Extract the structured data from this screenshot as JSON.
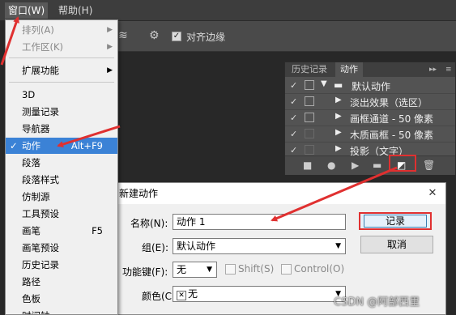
{
  "menubar": {
    "items": [
      {
        "label": "窗口(W)"
      },
      {
        "label": "帮助(H)"
      }
    ]
  },
  "options_bar": {
    "align_edges_label": "对齐边缘",
    "icons": [
      "layers-icon",
      "gear-icon"
    ]
  },
  "window_menu": {
    "items": [
      {
        "label": "排列(A)",
        "disabled": true,
        "submenu": true
      },
      {
        "label": "工作区(K)",
        "disabled": true,
        "submenu": true
      },
      {
        "label": "扩展功能",
        "submenu": true
      },
      {
        "label": "3D"
      },
      {
        "label": "测量记录"
      },
      {
        "label": "导航器"
      },
      {
        "label": "动作",
        "shortcut": "Alt+F9",
        "checked": true,
        "highlighted": true
      },
      {
        "label": "段落"
      },
      {
        "label": "段落样式"
      },
      {
        "label": "仿制源"
      },
      {
        "label": "工具预设"
      },
      {
        "label": "画笔",
        "shortcut": "F5"
      },
      {
        "label": "画笔预设"
      },
      {
        "label": "历史记录"
      },
      {
        "label": "路径"
      },
      {
        "label": "色板"
      },
      {
        "label": "时间轴"
      }
    ]
  },
  "actions_panel": {
    "tabs": [
      {
        "label": "历史记录",
        "active": false
      },
      {
        "label": "动作",
        "active": true
      }
    ],
    "rows": [
      {
        "label": "默认动作",
        "type": "set",
        "checked": true,
        "dialog_toggle": true
      },
      {
        "label": "淡出效果（选区）",
        "type": "action",
        "checked": true,
        "dialog_toggle": true
      },
      {
        "label": "画框通道 - 50 像素",
        "type": "action",
        "checked": true,
        "dialog_toggle": true
      },
      {
        "label": "木质画框 - 50 像素",
        "type": "action",
        "checked": true,
        "dialog_toggle": false
      },
      {
        "label": "投影（文字）",
        "type": "action",
        "checked": true,
        "dialog_toggle": false
      }
    ],
    "footer_icons": [
      "stop-icon",
      "record-icon",
      "play-icon",
      "folder-icon",
      "new-action-icon",
      "trash-icon"
    ]
  },
  "new_action_dialog": {
    "title": "新建动作",
    "name_label": "名称(N):",
    "name_value": "动作 1",
    "group_label": "组(E):",
    "group_value": "默认动作",
    "fkey_label": "功能键(F):",
    "fkey_value": "无",
    "shift_label": "Shift(S)",
    "control_label": "Control(O)",
    "color_label": "颜色(C):",
    "color_value": "无",
    "record_button": "记录",
    "cancel_button": "取消"
  },
  "watermark": "CSDN @阿部西里",
  "colors": {
    "highlight": "#3b82d6",
    "annotation_red": "#e03030"
  }
}
